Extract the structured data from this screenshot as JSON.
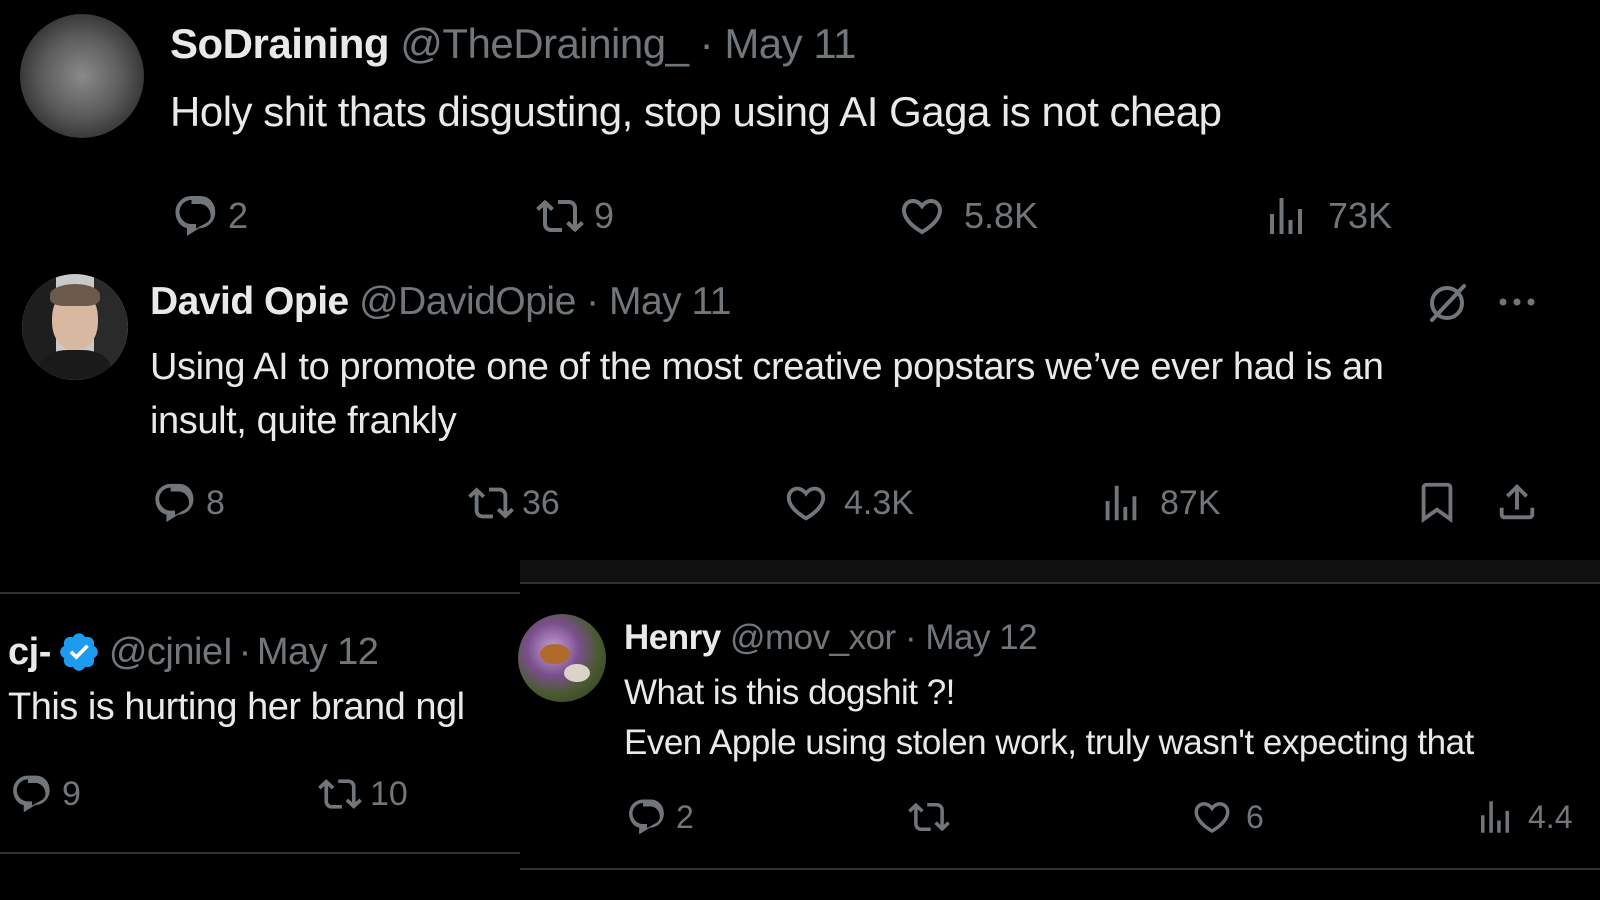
{
  "tweets": [
    {
      "name": "SoDraining",
      "handle": "@TheDraining_",
      "date": "May 11",
      "text": [
        "Holy shit thats disgusting, stop using AI Gaga is not cheap"
      ],
      "replies": "2",
      "retweets": "9",
      "likes": "5.8K",
      "views": "73K"
    },
    {
      "name": "David Opie",
      "handle": "@DavidOpie",
      "date": "May 11",
      "text": [
        "Using AI to promote one of the most creative popstars we’ve ever had is an",
        "insult, quite frankly"
      ],
      "replies": "8",
      "retweets": "36",
      "likes": "4.3K",
      "views": "87K"
    },
    {
      "name": "cj-",
      "handle": "@cjnieI",
      "date": "May 12",
      "text": [
        "This is hurting her brand ngl"
      ],
      "replies": "9",
      "retweets": "10"
    },
    {
      "name": "Henry",
      "handle": "@mov_xor",
      "date": "May 12",
      "text": [
        "What is this dogshit ?!",
        "Even Apple using stolen work, truly wasn't expecting that"
      ],
      "replies": "2",
      "likes": "6",
      "views": "4.4"
    }
  ],
  "separator": "·",
  "icons": {
    "reply": "reply-icon",
    "retweet": "retweet-icon",
    "like": "heart-icon",
    "views": "views-icon",
    "bookmark": "bookmark-icon",
    "share": "share-icon",
    "grok": "grok-icon",
    "more": "more-icon",
    "verified": "verified-badge-icon"
  },
  "colors": {
    "background": "#000000",
    "text": "#e7e9ea",
    "muted": "#71767b",
    "verified": "#1d9bf0"
  }
}
